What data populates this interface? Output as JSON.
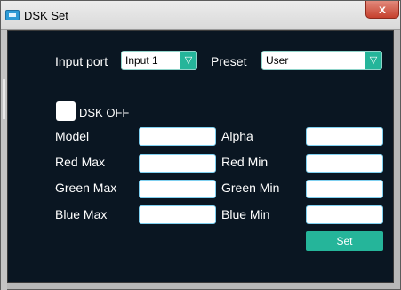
{
  "window": {
    "title": "DSK Set",
    "close_glyph": "x",
    "app_icon": "monitor-icon"
  },
  "input_port": {
    "label": "Input port",
    "value": "Input 1",
    "arrow_glyph": "▽"
  },
  "preset": {
    "label": "Preset",
    "value": "User",
    "arrow_glyph": "▽"
  },
  "dsk": {
    "label": "DSK OFF",
    "checked": false
  },
  "fields": {
    "model": {
      "label": "Model",
      "value": ""
    },
    "alpha": {
      "label": "Alpha",
      "value": ""
    },
    "red_max": {
      "label": "Red Max",
      "value": ""
    },
    "red_min": {
      "label": "Red Min",
      "value": ""
    },
    "green_max": {
      "label": "Green Max",
      "value": ""
    },
    "green_min": {
      "label": "Green Min",
      "value": ""
    },
    "blue_max": {
      "label": "Blue Max",
      "value": ""
    },
    "blue_min": {
      "label": "Blue Min",
      "value": ""
    }
  },
  "set_button": {
    "label": "Set"
  },
  "colors": {
    "panel_background": "#0a1622",
    "accent": "#25b59a",
    "field_border": "#7fd0f0",
    "text": "#ffffff"
  }
}
